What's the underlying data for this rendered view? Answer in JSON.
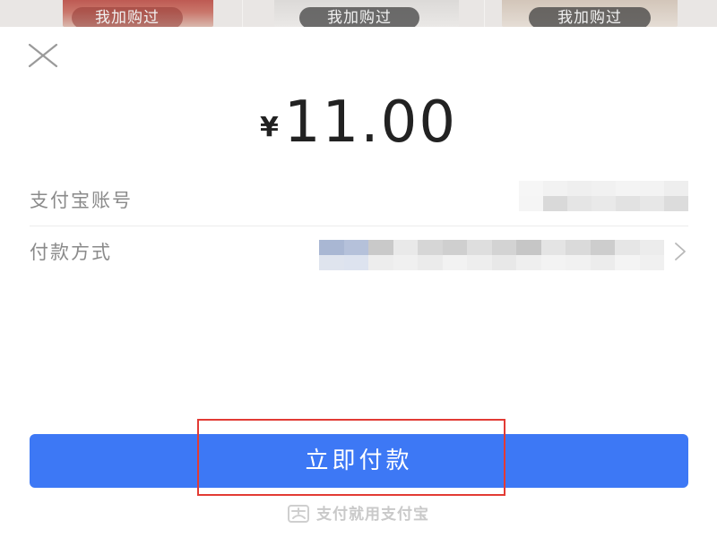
{
  "background": {
    "cards": [
      {
        "label": "我加购过"
      },
      {
        "label": "我加购过"
      },
      {
        "label": "我加购过"
      }
    ]
  },
  "sheet": {
    "close_icon": "close-icon",
    "amount": {
      "currency": "¥",
      "value": "11.00"
    },
    "rows": [
      {
        "label": "支付宝账号",
        "value": "",
        "value_obscured": true
      },
      {
        "label": "付款方式",
        "value": "",
        "value_obscured": true,
        "trailing_icon": "chevron-right-icon"
      }
    ],
    "pay_button": {
      "label": "立即付款",
      "highlighted": true
    },
    "footer": {
      "logo_icon": "alipay-logo-icon",
      "text": "支付就用支付宝"
    }
  },
  "colors": {
    "accent": "#3d78f5",
    "highlight_border": "#e23b34",
    "amount_text": "#222222",
    "label_text": "#8a8a8a",
    "footer_text": "#c9c9c9"
  }
}
